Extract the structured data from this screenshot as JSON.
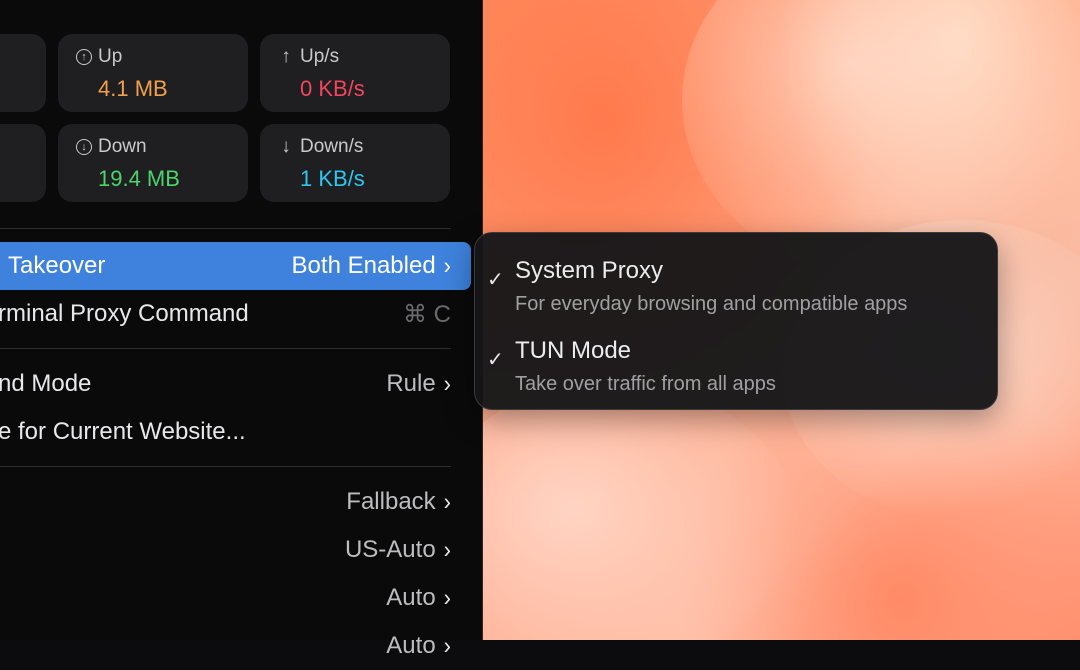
{
  "stats": {
    "up": {
      "label": "Up",
      "value": "4.1 MB",
      "color": "#f0a04b"
    },
    "up_rate": {
      "label": "Up/s",
      "value": "0 KB/s",
      "color": "#f2455e"
    },
    "down": {
      "label": "Down",
      "value": "19.4 MB",
      "color": "#4cd46b"
    },
    "down_rate": {
      "label": "Down/s",
      "value": "1 KB/s",
      "color": "#2ec6f0"
    }
  },
  "icons": {
    "up": "↑",
    "down": "↓"
  },
  "menu": {
    "takeover": {
      "label": "Takeover",
      "value": "Both Enabled"
    },
    "terminal": {
      "label": "rminal Proxy Command",
      "shortcut": "⌘ C"
    },
    "mode": {
      "label": "nd Mode",
      "value": "Rule"
    },
    "website": {
      "label": "e for Current Website..."
    },
    "groups": [
      {
        "label": "Fallback"
      },
      {
        "label": "US-Auto"
      },
      {
        "label": "Auto"
      },
      {
        "label": "Auto"
      }
    ]
  },
  "submenu": {
    "items": [
      {
        "title": "System Proxy",
        "description": "For everyday browsing and compatible apps",
        "checked": "✓"
      },
      {
        "title": "TUN Mode",
        "description": "Take over traffic from all apps",
        "checked": "✓"
      }
    ]
  },
  "glyphs": {
    "chevron": "›"
  }
}
